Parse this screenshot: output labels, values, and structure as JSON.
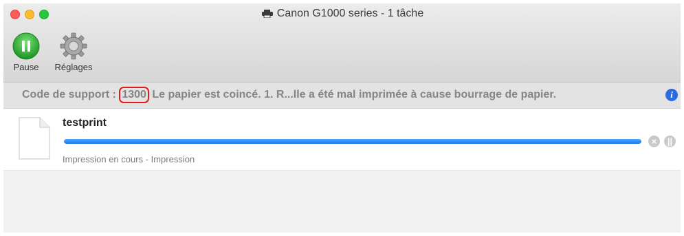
{
  "window": {
    "title": "Canon G1000 series - 1 tâche",
    "title_icon": "printer-icon"
  },
  "toolbar": {
    "pause_label": "Pause",
    "pause_icon": "pause-icon",
    "settings_label": "Réglages",
    "settings_icon": "gear-icon"
  },
  "status": {
    "prefix": "Code de support : ",
    "code": "1300",
    "message": " Le papier est coincé.  1. R...lle a été mal imprimée à cause bourrage de papier.",
    "info_icon": "info-icon",
    "info_glyph": "i"
  },
  "jobs": [
    {
      "name": "testprint",
      "status": "Impression en cours - Impression",
      "progress": 1.0,
      "cancel_glyph": "×",
      "hold_glyph": "||"
    }
  ],
  "colors": {
    "accent": "#1a78ea",
    "highlight": "#e21b1b",
    "pause_green": "#2fb42f"
  }
}
